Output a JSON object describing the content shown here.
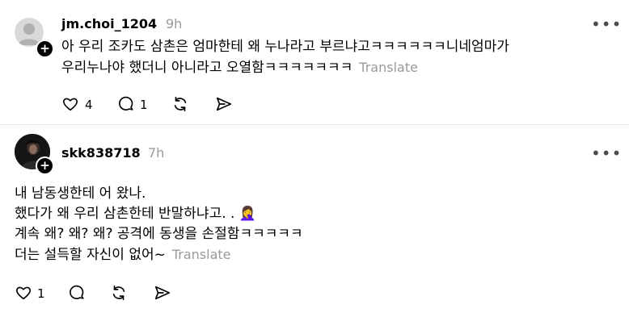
{
  "posts": [
    {
      "username": "jm.choi_1204",
      "time": "9h",
      "lines": [
        "아 우리 조카도 삼촌은 엄마한테 왜 누나라고 부르냐고ㅋㅋㅋㅋㅋㅋ니네엄마가",
        "우리누나야 했더니 아니라고 오열함ㅋㅋㅋㅋㅋㅋㅋ"
      ],
      "translate_label": "Translate",
      "likes": "4",
      "replies": "1"
    },
    {
      "username": "skk838718",
      "time": "7h",
      "lines": [
        "내 남동생한테 어 왔나.",
        "했다가 왜 우리 삼촌한테 반말하냐고. . 🤦‍♀️",
        "계속 왜? 왜? 왜? 공격에 동생을 손절함ㅋㅋㅋㅋㅋ",
        "더는 설득할 자신이 없어~"
      ],
      "translate_label": "Translate",
      "likes": "1"
    }
  ],
  "more_label": "•••"
}
